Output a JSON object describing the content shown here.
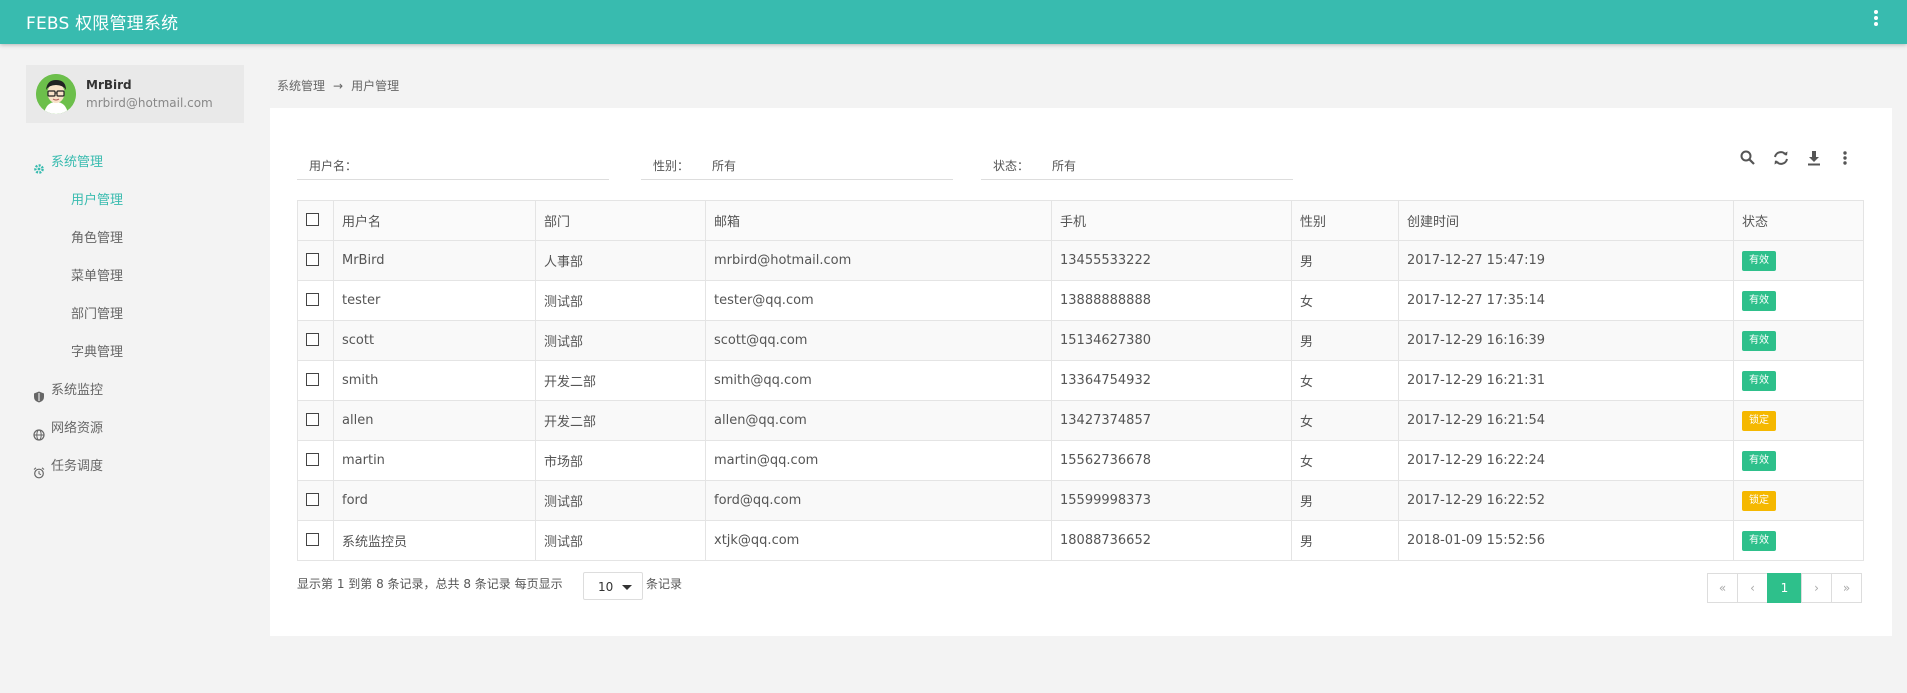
{
  "app": {
    "title": "FEBS 权限管理系统"
  },
  "user": {
    "name": "MrBird",
    "email": "mrbird@hotmail.com"
  },
  "nav": {
    "system": "系统管理",
    "sub": [
      "用户管理",
      "角色管理",
      "菜单管理",
      "部门管理",
      "字典管理"
    ],
    "monitor": "系统监控",
    "network": "网络资源",
    "schedule": "任务调度"
  },
  "breadcrumb": {
    "parent": "系统管理",
    "separator": "→",
    "current": "用户管理"
  },
  "filters": {
    "username": {
      "label": "用户名：",
      "value": ""
    },
    "gender": {
      "label": "性别：",
      "value": "所有"
    },
    "status": {
      "label": "状态：",
      "value": "所有"
    }
  },
  "table": {
    "headers": [
      "用户名",
      "部门",
      "邮箱",
      "手机",
      "性别",
      "创建时间",
      "状态"
    ],
    "rows": [
      [
        "MrBird",
        "人事部",
        "mrbird@hotmail.com",
        "13455533222",
        "男",
        "2017-12-27 15:47:19",
        "有效"
      ],
      [
        "tester",
        "测试部",
        "tester@qq.com",
        "13888888888",
        "女",
        "2017-12-27 17:35:14",
        "有效"
      ],
      [
        "scott",
        "测试部",
        "scott@qq.com",
        "15134627380",
        "男",
        "2017-12-29 16:16:39",
        "有效"
      ],
      [
        "smith",
        "开发二部",
        "smith@qq.com",
        "13364754932",
        "女",
        "2017-12-29 16:21:31",
        "有效"
      ],
      [
        "allen",
        "开发二部",
        "allen@qq.com",
        "13427374857",
        "女",
        "2017-12-29 16:21:54",
        "锁定"
      ],
      [
        "martin",
        "市场部",
        "martin@qq.com",
        "15562736678",
        "女",
        "2017-12-29 16:22:24",
        "有效"
      ],
      [
        "ford",
        "测试部",
        "ford@qq.com",
        "15599998373",
        "男",
        "2017-12-29 16:22:52",
        "锁定"
      ],
      [
        "系统监控员",
        "测试部",
        "xtjk@qq.com",
        "18088736652",
        "男",
        "2018-01-09 15:52:56",
        "有效"
      ]
    ]
  },
  "colors": {
    "primary": "#38bbaf",
    "valid": "#2ec08b",
    "locked": "#f5b800"
  },
  "footer": {
    "info": "显示第 1 到第 8 条记录，总共 8 条记录 每页显示",
    "page_size": "10",
    "tail": "条记录"
  },
  "pager": {
    "first": "«",
    "prev": "‹",
    "current": "1",
    "next": "›",
    "last": "»"
  }
}
